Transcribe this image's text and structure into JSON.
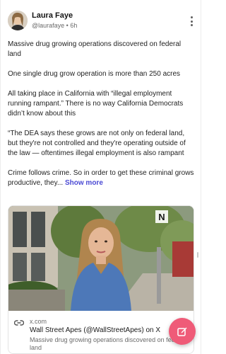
{
  "post": {
    "author": {
      "name": "Laura Faye",
      "handle": "@laurafaye",
      "time": "6h"
    },
    "paragraphs": [
      "Massive drug growing operations discovered on federal land",
      "One single drug grow operation is more than 250 acres",
      "All taking place in California with “illegal employment running rampant.” There is no way California Democrats didn’t know about this",
      "“The DEA says these grows are not only on federal land, but they're not controlled and they're operating outside of the law — oftentimes illegal employment is also rampant"
    ],
    "last_paragraph": "Crime follows crime. So in order to get these criminal grows productive, they...",
    "show_more_label": "Show more"
  },
  "link_card": {
    "domain": "x.com",
    "title": "Wall Street Apes (@WallStreetApes) on X",
    "description": "Massive drug growing operations discovered on federal land",
    "watermark": "N"
  },
  "icons": {
    "menu": "more-vertical-icon",
    "link": "link-icon",
    "compose": "compose-icon"
  },
  "colors": {
    "accent": "#4b4ad4",
    "fab": "#ef5b78"
  }
}
